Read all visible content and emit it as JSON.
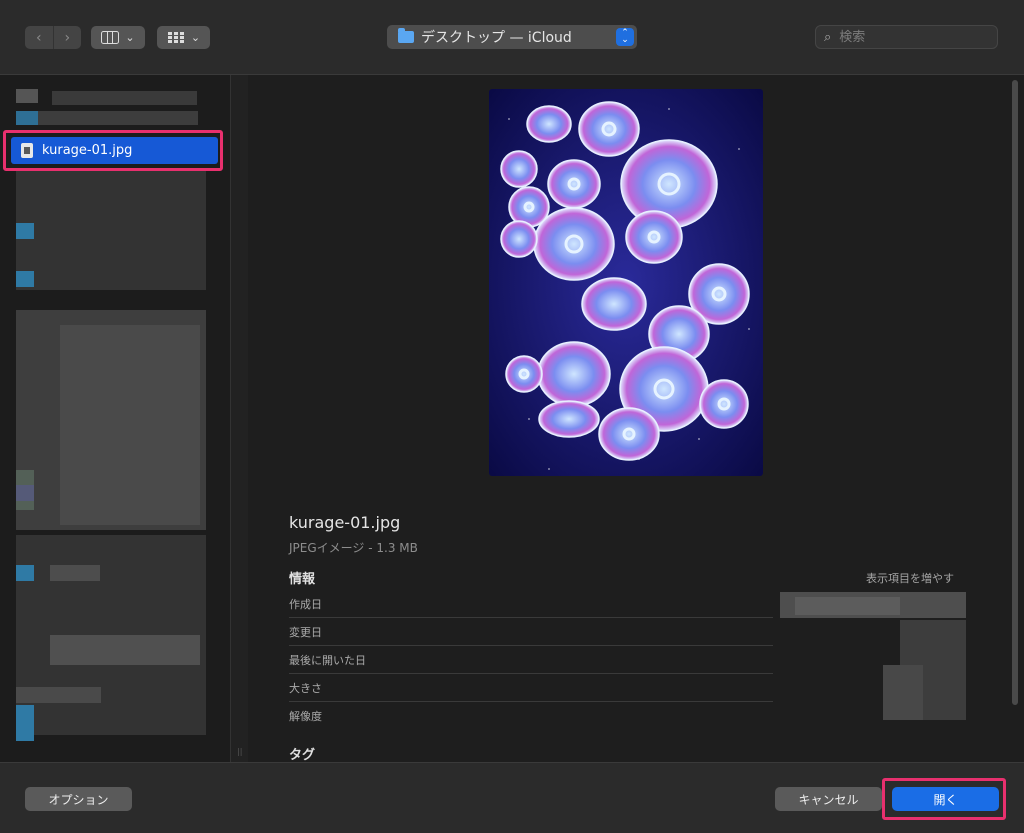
{
  "toolbar": {
    "back_icon": "chevron-left-icon",
    "forward_icon": "chevron-right-icon",
    "view_column_icon": "column-view-icon",
    "view_grid_icon": "grid-view-icon",
    "location_label": "デスクトップ — iCloud",
    "search_placeholder": "検索"
  },
  "sidebar": {
    "selected_file": "kurage-01.jpg"
  },
  "preview": {
    "file_name": "kurage-01.jpg",
    "file_kind": "JPEGイメージ - 1.3 MB",
    "info_heading": "情報",
    "show_more": "表示項目を増やす",
    "rows": [
      {
        "label": "作成日"
      },
      {
        "label": "変更日"
      },
      {
        "label": "最後に開いた日"
      },
      {
        "label": "大きさ"
      },
      {
        "label": "解像度"
      }
    ],
    "tags_heading": "タグ"
  },
  "footer": {
    "options_label": "オプション",
    "cancel_label": "キャンセル",
    "open_label": "開く"
  },
  "colors": {
    "accent": "#1a6de6",
    "highlight": "#e8306e"
  }
}
